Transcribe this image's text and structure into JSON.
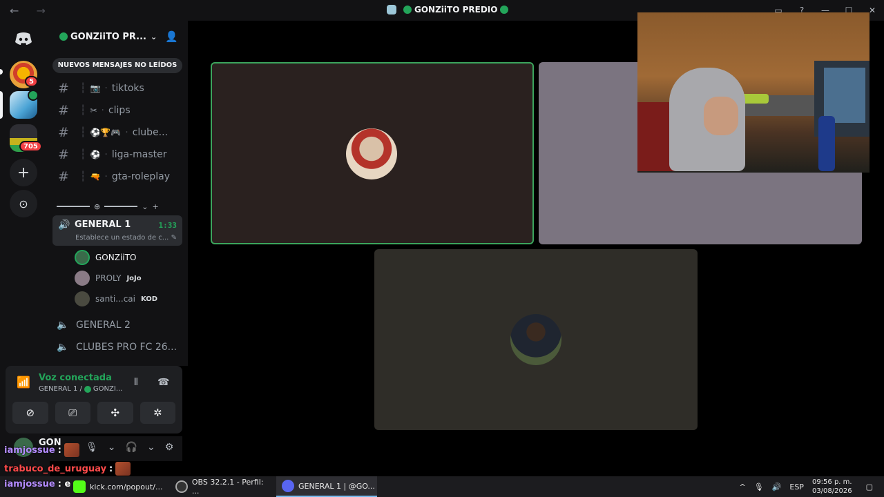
{
  "titlebar": {
    "title": "GONZiiTO PREDIO",
    "back": "←",
    "forward": "→",
    "icons": [
      "inbox-icon",
      "help-icon",
      "minimize-icon",
      "maximize-icon",
      "close-icon"
    ],
    "minimize": "—",
    "maximize": "☐",
    "close": "✕",
    "inbox": "▭",
    "help": "?"
  },
  "rail": {
    "home_label": "Discord",
    "servers": [
      {
        "badge": "5"
      },
      {
        "badge": ""
      },
      {
        "badge": "705"
      }
    ],
    "add": "+",
    "explore": "⊙"
  },
  "sidebar": {
    "server_name": "GONZiiTO PR...",
    "unread_banner": "NUEVOS MENSAJES NO LEÍDOS",
    "text_channels": [
      {
        "emoji": "📷",
        "name": "tiktoks"
      },
      {
        "emoji": "✂",
        "name": "clips"
      },
      {
        "emoji": "⚽🏆🎮",
        "name": "clube..."
      },
      {
        "emoji": "⚽",
        "name": "liga-master"
      },
      {
        "emoji": "🔫",
        "name": "gta-roleplay"
      }
    ],
    "divider_icon": "⊕",
    "divider_add": "+",
    "active_voice": {
      "name": "GENERAL 1",
      "time": "1:33",
      "status": "Establece un estado de c..."
    },
    "voice_users": [
      {
        "name": "GONZiiTO",
        "tag": ""
      },
      {
        "name": "PROLY",
        "tag": "JoJo"
      },
      {
        "name": "santi...cai",
        "tag": "KOD"
      }
    ],
    "voice_channels": [
      {
        "name": "GENERAL 2"
      },
      {
        "name": "CLUBES PRO FC 26..."
      }
    ]
  },
  "voice_panel": {
    "title": "Voz conectada",
    "sub_channel": "GENERAL 1 /",
    "sub_server": "GONZI...",
    "buttons": [
      "camera-off",
      "screen-share",
      "activities",
      "soundboard"
    ],
    "btn_glyphs": [
      "⊘",
      "⎚",
      "✣",
      "✲"
    ],
    "noise": "⫴",
    "disconnect": "☎"
  },
  "userbar": {
    "name": "GON",
    "mic": "🎙",
    "headset": "🎧",
    "settings": "⚙"
  },
  "chat_overlay": [
    {
      "user": "iamjossue",
      "text": ":",
      "color": "#b48cff"
    },
    {
      "user": "trabuco_de_uruguay",
      "text": ":",
      "color": "#ff4a4a"
    },
    {
      "user": "iamjossue",
      "text": ": e",
      "color": "#b48cff"
    }
  ],
  "stage": {
    "tiles": [
      "participant-tile-1",
      "participant-tile-2",
      "participant-tile-3"
    ]
  },
  "taskbar": {
    "items": [
      {
        "label": "kick.com/popout/..."
      },
      {
        "label": "OBS 32.2.1 - Perfil: ..."
      },
      {
        "label": "GENERAL 1 | @GO..."
      }
    ],
    "language": "ESP",
    "time": "09:56 p. m.",
    "date": "03/08/2026",
    "tray_up": "^",
    "notif": "▢"
  },
  "colors": {
    "accent_green": "#23a55a",
    "speaking_border": "#3ba55c",
    "badge_red": "#f23f43"
  }
}
